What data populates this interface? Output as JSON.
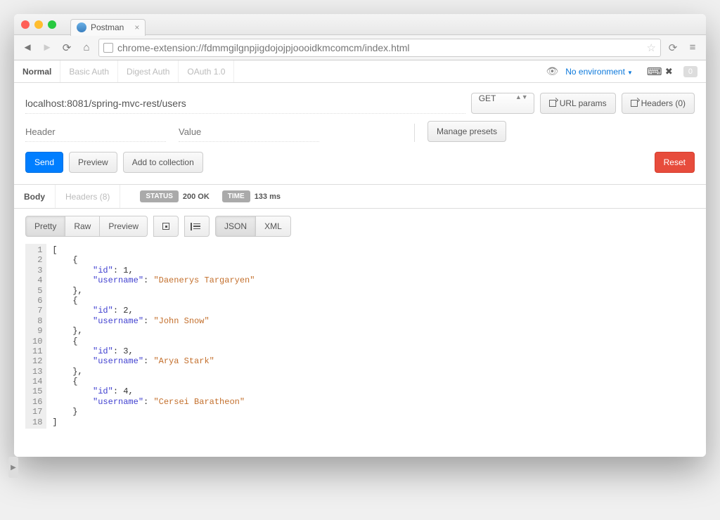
{
  "browser": {
    "tab_title": "Postman",
    "url": "chrome-extension://fdmmgilgnpjigdojojpjoooidkmcomcm/index.html"
  },
  "auth_tabs": {
    "normal": "Normal",
    "basic": "Basic Auth",
    "digest": "Digest Auth",
    "oauth": "OAuth 1.0"
  },
  "env": {
    "label": "No environment",
    "badge": "0"
  },
  "request": {
    "url": "localhost:8081/spring-mvc-rest/users",
    "method": "GET",
    "url_params_btn": "URL params",
    "headers_btn": "Headers (0)",
    "header_placeholder": "Header",
    "value_placeholder": "Value",
    "manage_presets": "Manage presets"
  },
  "actions": {
    "send": "Send",
    "preview": "Preview",
    "add_to_collection": "Add to collection",
    "reset": "Reset"
  },
  "response": {
    "body_tab": "Body",
    "headers_tab": "Headers (8)",
    "status_label": "STATUS",
    "status_value": "200 OK",
    "time_label": "TIME",
    "time_value": "133 ms"
  },
  "body_view": {
    "pretty": "Pretty",
    "raw": "Raw",
    "preview": "Preview",
    "json": "JSON",
    "xml": "XML"
  },
  "json_body": [
    {
      "id": 1,
      "username": "Daenerys Targaryen"
    },
    {
      "id": 2,
      "username": "John Snow"
    },
    {
      "id": 3,
      "username": "Arya Stark"
    },
    {
      "id": 4,
      "username": "Cersei Baratheon"
    }
  ]
}
